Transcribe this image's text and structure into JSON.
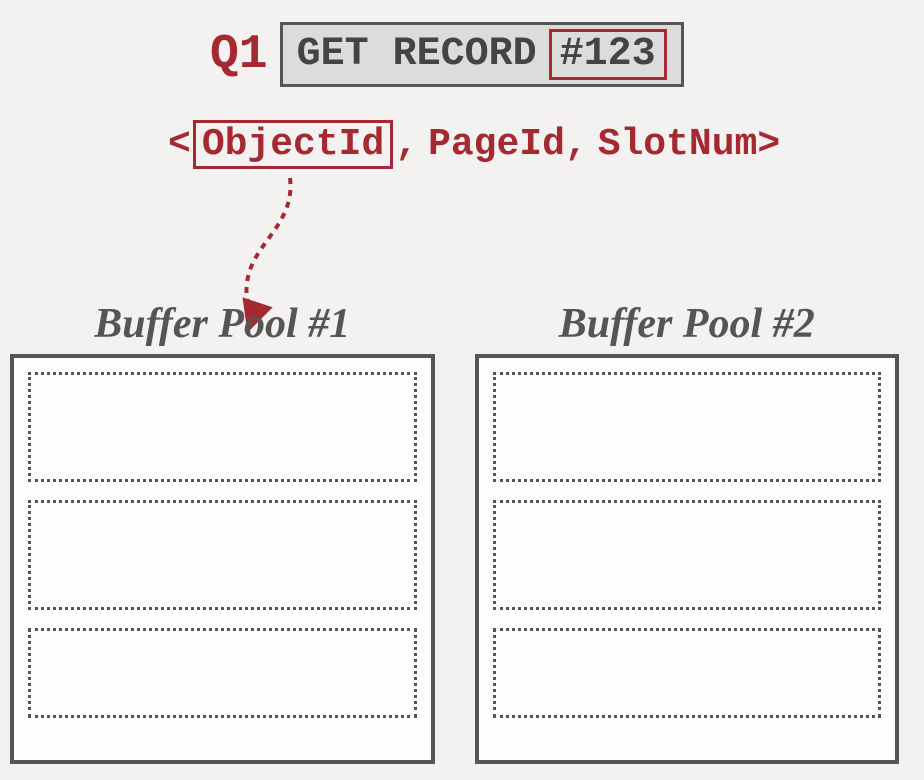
{
  "query": {
    "label": "Q1",
    "command": "GET RECORD",
    "record_id": "#123"
  },
  "tuple": {
    "open": "<",
    "field1": "ObjectId",
    "sep1": ",",
    "field2": "PageId,",
    "field3": "SlotNum",
    "close": ">"
  },
  "pools": [
    {
      "title": "Buffer Pool #1"
    },
    {
      "title": "Buffer Pool #2"
    }
  ],
  "colors": {
    "accent": "#a52931",
    "border": "#555",
    "bg": "#f4f2f0"
  }
}
